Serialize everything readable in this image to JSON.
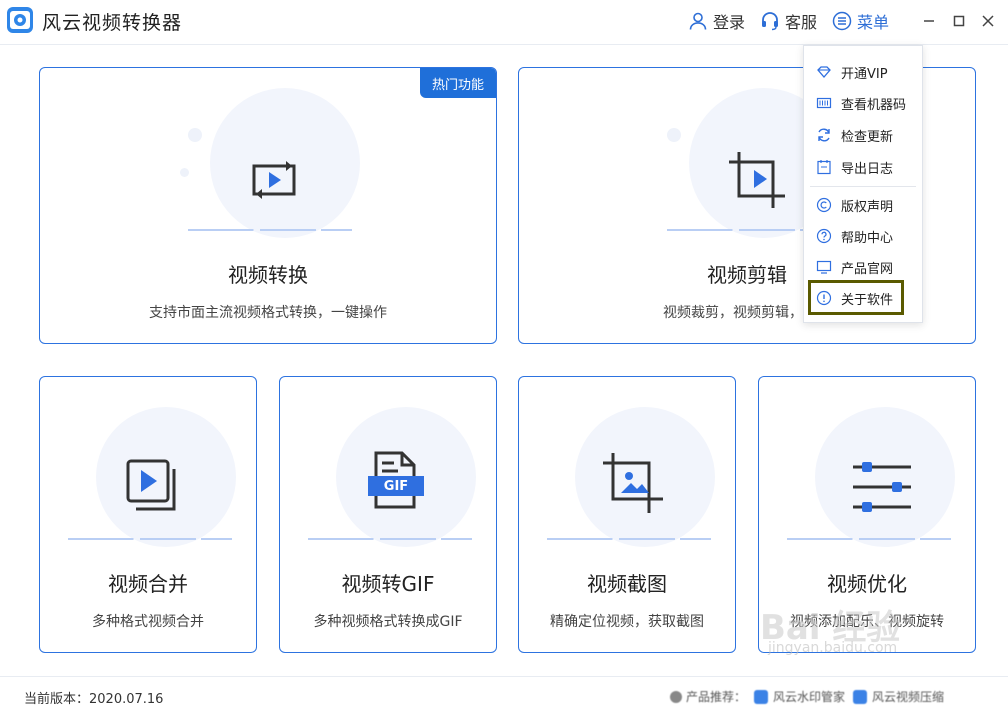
{
  "app": {
    "title": "风云视频转换器"
  },
  "titlebar": {
    "login": "登录",
    "service": "客服",
    "menu": "菜单"
  },
  "cards": {
    "convert": {
      "title": "视频转换",
      "desc": "支持市面主流视频格式转换，一键操作",
      "badge": "热门功能"
    },
    "edit": {
      "title": "视频剪辑",
      "desc": "视频裁剪，视频剪辑，一键"
    },
    "merge": {
      "title": "视频合并",
      "desc": "多种格式视频合并"
    },
    "gif": {
      "title": "视频转GIF",
      "desc": "多种视频格式转换成GIF",
      "icon_text": "GIF"
    },
    "screenshot": {
      "title": "视频截图",
      "desc": "精确定位视频，获取截图"
    },
    "optimize": {
      "title": "视频优化",
      "desc": "视频添加配乐、视频旋转"
    }
  },
  "menu": {
    "items": [
      {
        "label": "开通VIP",
        "icon": "diamond-icon"
      },
      {
        "label": "查看机器码",
        "icon": "barcode-icon"
      },
      {
        "label": "检查更新",
        "icon": "refresh-icon"
      },
      {
        "label": "导出日志",
        "icon": "export-log-icon"
      },
      {
        "label": "版权声明",
        "icon": "copyright-icon"
      },
      {
        "label": "帮助中心",
        "icon": "help-icon"
      },
      {
        "label": "产品官网",
        "icon": "monitor-icon"
      },
      {
        "label": "关于软件",
        "icon": "info-icon"
      }
    ]
  },
  "footer": {
    "version": "当前版本：2020.07.16",
    "recommend_label": "产品推荐：",
    "recommend_1": "风云水印管家",
    "recommend_2": "风云视频压缩"
  },
  "watermark": {
    "main": "Bai 经验",
    "sub": "jingyan.baidu.com"
  },
  "colors": {
    "accent": "#2d73e0",
    "badge": "#1f6fd9",
    "icon": "#2f6fe0"
  }
}
